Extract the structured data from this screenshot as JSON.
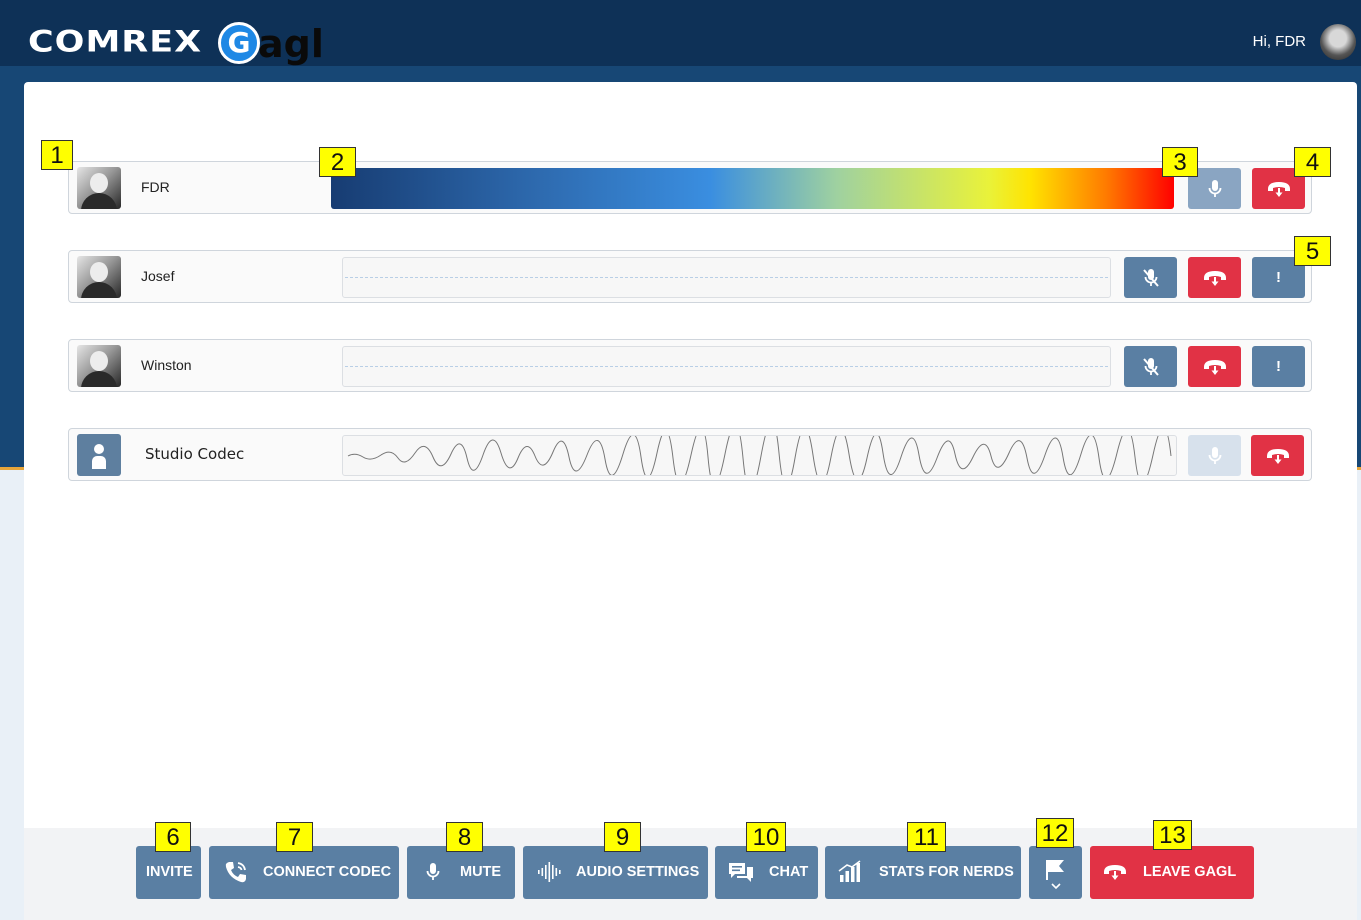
{
  "header": {
    "brand": "COMREX",
    "app_logo_g": "G",
    "app_logo_rest": "agl",
    "greeting": "Hi, FDR"
  },
  "participants": [
    {
      "name": "FDR",
      "avatar": "photo",
      "meter": "active"
    },
    {
      "name": "Josef",
      "avatar": "photo",
      "meter": "flat",
      "extra_button": "!"
    },
    {
      "name": "Winston",
      "avatar": "photo",
      "meter": "flat",
      "extra_button": "!"
    },
    {
      "name": "Studio Codec",
      "avatar": "placeholder",
      "meter": "waveform"
    }
  ],
  "toolbar": {
    "invite": "INVITE",
    "connect_codec": "CONNECT CODEC",
    "mute": "MUTE",
    "audio_settings": "AUDIO SETTINGS",
    "chat": "CHAT",
    "stats_for_nerds": "STATS FOR NERDS",
    "leave": "LEAVE GAGL"
  },
  "callouts": [
    "1",
    "2",
    "3",
    "4",
    "5",
    "6",
    "7",
    "8",
    "9",
    "10",
    "11",
    "12",
    "13"
  ],
  "colors": {
    "header_bg": "#0e3157",
    "panel_blue": "#174775",
    "button_blue": "#5a7fa3",
    "button_red": "#e13245",
    "callout_yellow": "#ffff00"
  }
}
